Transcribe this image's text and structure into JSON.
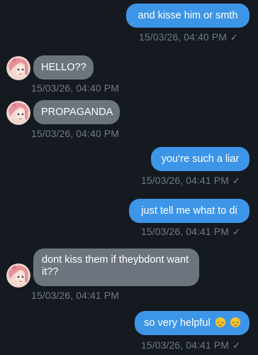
{
  "messages": [
    {
      "direction": "outgoing",
      "text": "and kisse him or smth",
      "time": "15/03/26, 04:40 PM",
      "status_icon": "single-check-icon"
    },
    {
      "direction": "incoming",
      "text": "HELLO??",
      "time": "15/03/26, 04:40 PM",
      "avatar_icon": "anime-avatar-icon"
    },
    {
      "direction": "incoming",
      "text": "PROPAGANDA",
      "time": "15/03/26, 04:40 PM",
      "avatar_icon": "anime-avatar-icon"
    },
    {
      "direction": "outgoing",
      "text": "you‘re such a liar",
      "time": "15/03/26, 04:41 PM",
      "status_icon": "single-check-icon"
    },
    {
      "direction": "outgoing",
      "text": "just tell me what to di",
      "time": "15/03/26, 04:41 PM",
      "status_icon": "single-check-icon"
    },
    {
      "direction": "incoming",
      "text": "dont kiss them if theybdont want it??",
      "time": "15/03/26, 04:41 PM",
      "avatar_icon": "anime-avatar-icon"
    },
    {
      "direction": "outgoing",
      "text": "so very helpful",
      "emoji": [
        "relieved-face-icon",
        "relieved-face-icon"
      ],
      "time": "15/03/26, 04:41 PM",
      "status_icon": "single-check-icon"
    }
  ],
  "check_glyph": "✓",
  "colors": {
    "background": "#151a21",
    "outgoing_bubble": "#3d95e7",
    "incoming_bubble": "#6c757d",
    "timestamp": "#707a85"
  }
}
